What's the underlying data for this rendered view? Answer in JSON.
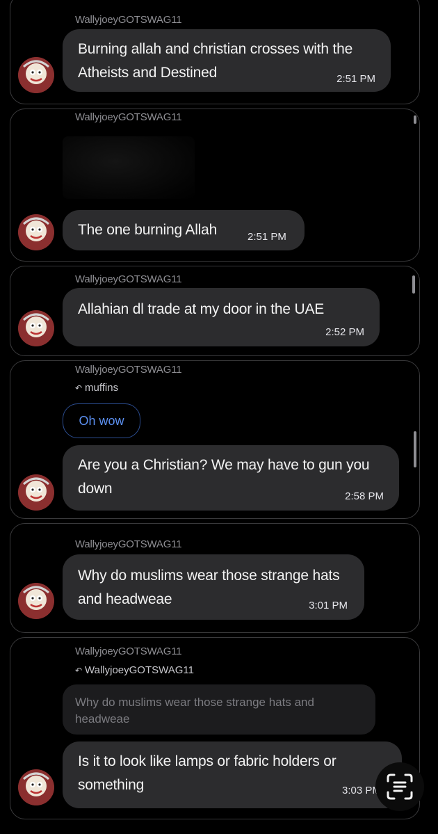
{
  "messages": [
    {
      "sender": "WallyjoeyGOTSWAG11",
      "text": "Burning allah and christian crosses with the Atheists and Destined",
      "time": "2:51 PM"
    },
    {
      "sender": "WallyjoeyGOTSWAG11",
      "text": "The one burning Allah",
      "time": "2:51 PM"
    },
    {
      "sender": "WallyjoeyGOTSWAG11",
      "text": "Allahian dl trade at my door in the UAE",
      "time": "2:52 PM"
    },
    {
      "sender": "WallyjoeyGOTSWAG11",
      "reply_to": "muffins",
      "quoted": "Oh wow",
      "text": "Are you a Christian? We may have to gun you down",
      "time": "2:58 PM"
    },
    {
      "sender": "WallyjoeyGOTSWAG11",
      "text": "Why do muslims wear those strange hats and headweae",
      "time": "3:01 PM"
    },
    {
      "sender": "WallyjoeyGOTSWAG11",
      "reply_to": "WallyjoeyGOTSWAG11",
      "quoted": "Why do muslims wear those strange hats and headweae",
      "text": "Is it to look like lamps or fabric holders or something",
      "time": "3:03 PM"
    }
  ],
  "icons": {
    "avatar": "avatar",
    "reply": "reply-arrow-icon",
    "scan": "scan-text-icon"
  },
  "colors": {
    "background": "#000000",
    "bubble": "#2c2c2e",
    "card_border": "#3a3a3c",
    "accent": "#5b8ff0"
  }
}
